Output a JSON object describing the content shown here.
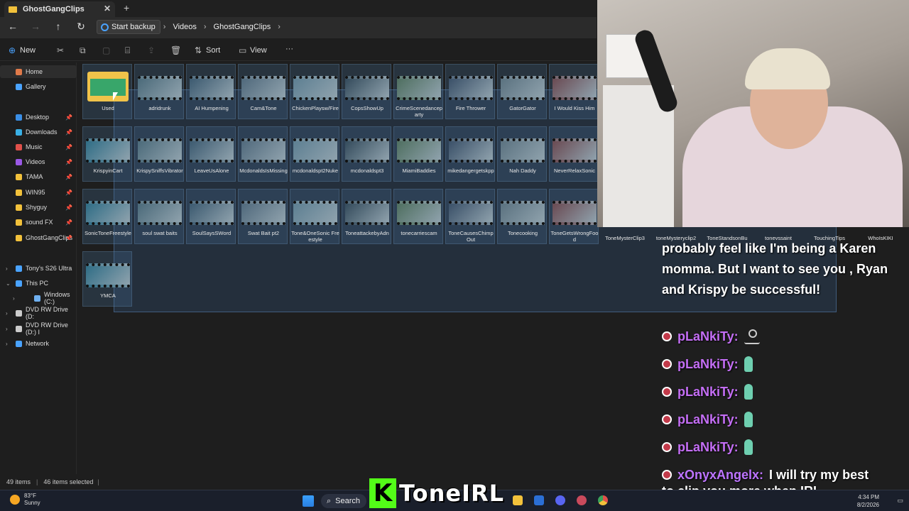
{
  "window": {
    "tab_title": "GhostGangClips",
    "tab_close": "✕",
    "new_tab": "+"
  },
  "address": {
    "back": "←",
    "forward": "→",
    "up": "↑",
    "refresh": "↻",
    "crumbs": [
      "Start backup",
      "Videos",
      "GhostGangClips"
    ],
    "sep": "›"
  },
  "toolbar": {
    "new_label": "New",
    "sort_label": "Sort",
    "view_label": "View",
    "more": "···"
  },
  "sidebar": {
    "quick": [
      {
        "label": "Home",
        "color": "#e07a4a"
      },
      {
        "label": "Gallery",
        "color": "#4aa3ff"
      },
      {
        "label": "Desktop",
        "color": "#3a8ee6"
      },
      {
        "label": "Downloads",
        "color": "#3ab0e6"
      },
      {
        "label": "Music",
        "color": "#e0504a"
      },
      {
        "label": "Videos",
        "color": "#9b59e6"
      },
      {
        "label": "TAMA",
        "color": "#f2c13b"
      },
      {
        "label": "WIN95",
        "color": "#f2c13b"
      },
      {
        "label": "Shyguy",
        "color": "#f2c13b"
      },
      {
        "label": "sound FX",
        "color": "#f2c13b"
      },
      {
        "label": "GhostGangClips",
        "color": "#f2c13b"
      }
    ],
    "devices": [
      {
        "label": "Tony's S26 Ultra"
      },
      {
        "label": "This PC"
      },
      {
        "label": "Windows (C:)"
      },
      {
        "label": "DVD RW Drive (D:"
      },
      {
        "label": "DVD RW Drive (D:) I"
      },
      {
        "label": "Network"
      }
    ]
  },
  "files": [
    "Used",
    "adridrunk",
    "AI Humpening",
    "Cam&Tone",
    "ChickenPlaysw/Fire",
    "CopsShowUp",
    "CrimeScenedanceparty",
    "Fire Thrower",
    "GatorGator",
    "I Would Kiss Him",
    "KrispyinCart",
    "KrispySniffsVibrator",
    "LeaveUsAlone",
    "McdonaldsIsMissing",
    "mcdonaldspt2Nuke",
    "mcdonaldspt3",
    "MiamiBaddies",
    "mikedangergetskpp",
    "Nah Daddy",
    "NeverRelaxSonic",
    "SonicToneFreestyle",
    "soul swat baits",
    "SoulSaysSWord",
    "Swat Bait pt2",
    "Tone&OneSonic Freestyle",
    "ToneattackebyAdn",
    "tonecarriescam",
    "ToneCausesChimpOut",
    "Tonecooking",
    "ToneGetsWrongFood",
    "YMCA"
  ],
  "overflow_files": [
    "ToneMysterClip3",
    "toneMysteryclip2",
    "ToneStandsonBu",
    "tonevssaint",
    "TouchingTips",
    "WhoIsKIKI"
  ],
  "status": {
    "items": "49 items",
    "selected": "46 items selected"
  },
  "taskbar": {
    "temp": "83°F",
    "weather": "Sunny",
    "search": "Search",
    "time": "4:34 PM",
    "date": "8/2/2026"
  },
  "chat": {
    "message_continuation": "probably feel like I'm being a Karen momma. But I want to see you , Ryan and Krispy be successful!",
    "lines": [
      {
        "user": "pLaNkiTy:"
      },
      {
        "user": "pLaNkiTy:"
      },
      {
        "user": "pLaNkiTy:"
      },
      {
        "user": "pLaNkiTy:"
      },
      {
        "user": "pLaNkiTy:"
      }
    ],
    "last_user": "xOnyxAngelx:",
    "last_msg_a": "I will try my best",
    "last_msg_b": "to clip you more when IRL"
  },
  "brand": {
    "logo_letter": "K",
    "channel": "ToneIRL",
    "accent": "#53fc18"
  }
}
